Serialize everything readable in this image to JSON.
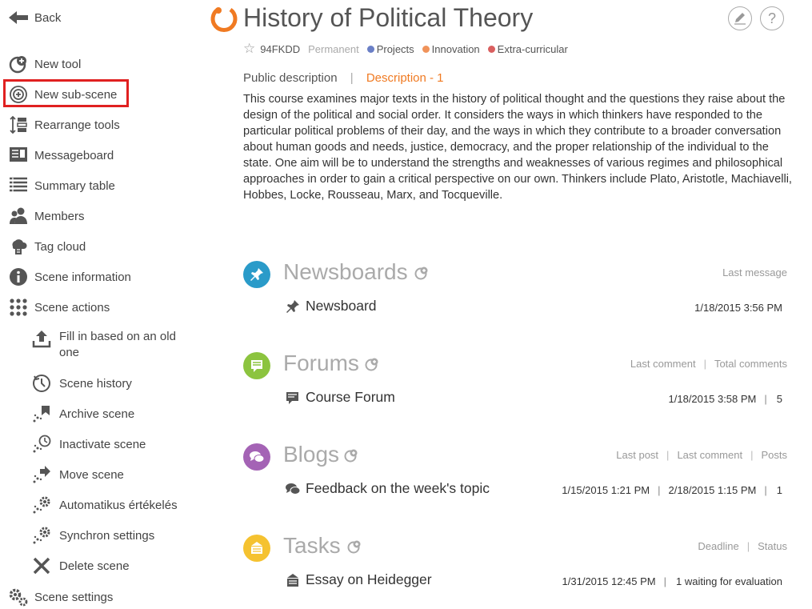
{
  "sidebar": {
    "back_label": "Back",
    "items": [
      {
        "label": "New tool",
        "icon": "new-tool-icon"
      },
      {
        "label": "New sub-scene",
        "icon": "new-sub-scene-icon"
      },
      {
        "label": "Rearrange tools",
        "icon": "rearrange-icon"
      },
      {
        "label": "Messageboard",
        "icon": "messageboard-icon"
      },
      {
        "label": "Summary table",
        "icon": "summary-table-icon"
      },
      {
        "label": "Members",
        "icon": "members-icon"
      },
      {
        "label": "Tag cloud",
        "icon": "tag-cloud-icon"
      },
      {
        "label": "Scene information",
        "icon": "info-icon"
      },
      {
        "label": "Scene actions",
        "icon": "grid-icon"
      }
    ],
    "sub_items": [
      {
        "label": "Fill in based on an old one",
        "icon": "upload-icon"
      },
      {
        "label": "Scene history",
        "icon": "history-icon"
      },
      {
        "label": "Archive scene",
        "icon": "archive-icon"
      },
      {
        "label": "Inactivate scene",
        "icon": "inactivate-icon"
      },
      {
        "label": "Move scene",
        "icon": "move-icon"
      },
      {
        "label": "Automatikus értékelés",
        "icon": "auto-eval-icon"
      },
      {
        "label": "Synchron settings",
        "icon": "sync-settings-icon"
      },
      {
        "label": "Delete scene",
        "icon": "delete-icon"
      }
    ],
    "settings_label": "Scene settings"
  },
  "header": {
    "title": "History of Political Theory",
    "code": "94FKDD",
    "permanence": "Permanent",
    "tags": [
      {
        "label": "Projects",
        "color": "#6a7fc6"
      },
      {
        "label": "Innovation",
        "color": "#f0935a"
      },
      {
        "label": "Extra-curricular",
        "color": "#d95f5f"
      }
    ]
  },
  "description": {
    "tab_public": "Public description",
    "tab_active": "Description - 1",
    "text": "This course examines major texts in the history of political thought and the questions they raise about the design of the political and social order. It considers the ways in which thinkers have responded to the particular political problems of their day, and the ways in which they contribute to a broader conversation about human goods and needs, justice, democracy, and the proper relationship of the individual to the state. One aim will be to understand the strengths and weaknesses of various regimes and philosophical approaches in order to gain a critical perspective on our own. Thinkers include Plato, Aristotle, Machiavelli, Hobbes, Locke, Rousseau, Marx, and Tocqueville."
  },
  "sections": {
    "newsboards": {
      "title": "Newsboards",
      "headers": [
        "Last message"
      ],
      "item": "Newsboard",
      "values": [
        "1/18/2015 3:56 PM"
      ],
      "color": "#2a9bc9"
    },
    "forums": {
      "title": "Forums",
      "headers": [
        "Last comment",
        "Total comments"
      ],
      "item": "Course Forum",
      "values": [
        "1/18/2015 3:58 PM",
        "5"
      ],
      "color": "#8cc43f"
    },
    "blogs": {
      "title": "Blogs",
      "headers": [
        "Last post",
        "Last comment",
        "Posts"
      ],
      "item": "Feedback on the week's topic",
      "values": [
        "1/15/2015 1:21 PM",
        "2/18/2015 1:15 PM",
        "1"
      ],
      "color": "#a463b5"
    },
    "tasks": {
      "title": "Tasks",
      "headers": [
        "Deadline",
        "Status"
      ],
      "item": "Essay on Heidegger",
      "values": [
        "1/31/2015 12:45 PM",
        "1 waiting for evaluation"
      ],
      "color": "#f5c230"
    }
  },
  "colors": {
    "accent": "#f07a22",
    "highlight": "#e02020"
  }
}
